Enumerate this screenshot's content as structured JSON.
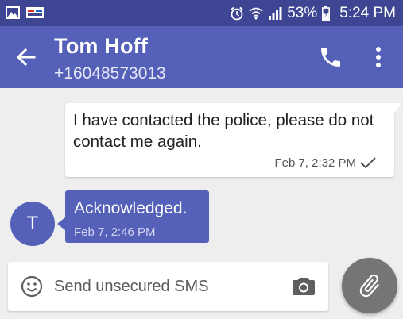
{
  "status_bar": {
    "battery": "53%",
    "time": "5:24 PM",
    "icons": [
      "image-icon",
      "card-icon",
      "alarm-icon",
      "wifi-icon",
      "signal-icon",
      "battery-icon"
    ]
  },
  "header": {
    "contact_name": "Tom Hoff",
    "contact_number": "+16048573013",
    "icons": [
      "back-arrow-icon",
      "phone-icon",
      "more-vert-icon"
    ]
  },
  "messages": [
    {
      "direction": "outgoing",
      "text": "I have contacted the police, please do not contact me again.",
      "time": "Feb 7, 2:32 PM",
      "status_icon": "check-icon"
    },
    {
      "direction": "incoming",
      "avatar_letter": "T",
      "text": "Acknowledged.",
      "time": "Feb 7, 2:46 PM"
    }
  ],
  "composer": {
    "placeholder": "Send unsecured SMS",
    "icons": [
      "emoji-icon",
      "camera-icon",
      "attach-icon"
    ]
  },
  "colors": {
    "status_bar": "#3e4592",
    "primary": "#5560b8",
    "background": "#eeeeee",
    "fab": "#757575"
  }
}
